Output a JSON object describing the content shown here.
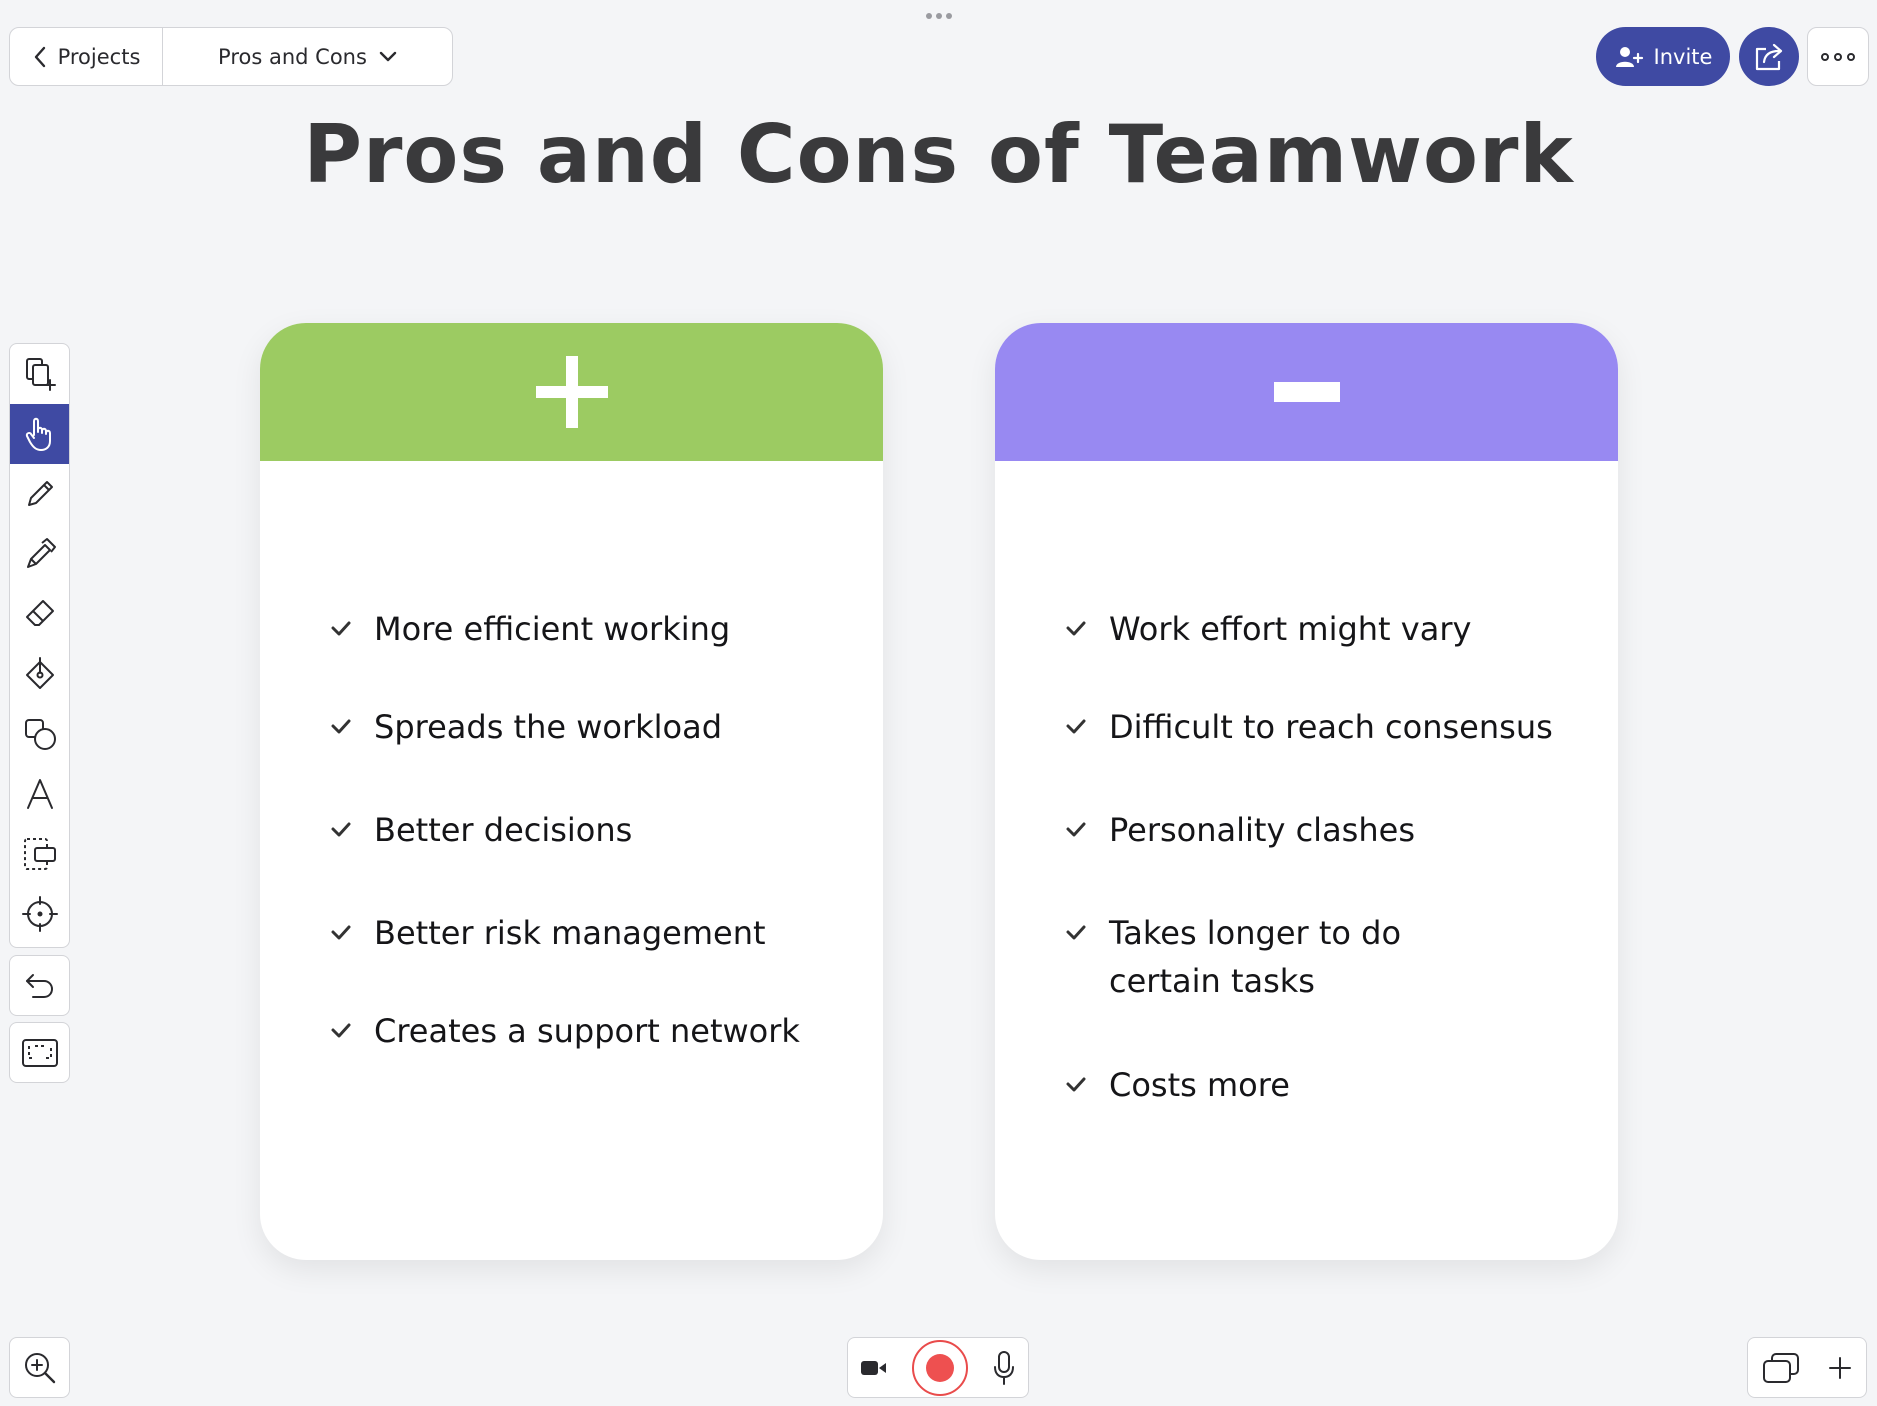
{
  "breadcrumb": {
    "back_label": "Projects",
    "current_label": "Pros and Cons"
  },
  "header": {
    "invite_label": "Invite"
  },
  "title": "Pros and Cons of Teamwork",
  "colors": {
    "accent": "#3f4aa3",
    "pros_header": "#9ccb62",
    "cons_header": "#9889f2",
    "record": "#ee5050"
  },
  "toolbar": {
    "tools": [
      "add-page-icon",
      "hand-icon",
      "pencil-icon",
      "marker-icon",
      "eraser-icon",
      "fill-icon",
      "shapes-icon",
      "text-icon",
      "select-icon",
      "laser-pointer-icon"
    ],
    "active_tool": "hand-icon"
  },
  "pros": {
    "symbol": "plus-icon",
    "items": [
      "More efficient working",
      "Spreads the workload",
      "Better decisions",
      "Better risk management",
      "Creates a support network"
    ]
  },
  "cons": {
    "symbol": "minus-icon",
    "items": [
      "Work effort might vary",
      "Difficult to reach consensus",
      "Personality clashes",
      "Takes longer to do certain tasks",
      "Costs more"
    ]
  }
}
